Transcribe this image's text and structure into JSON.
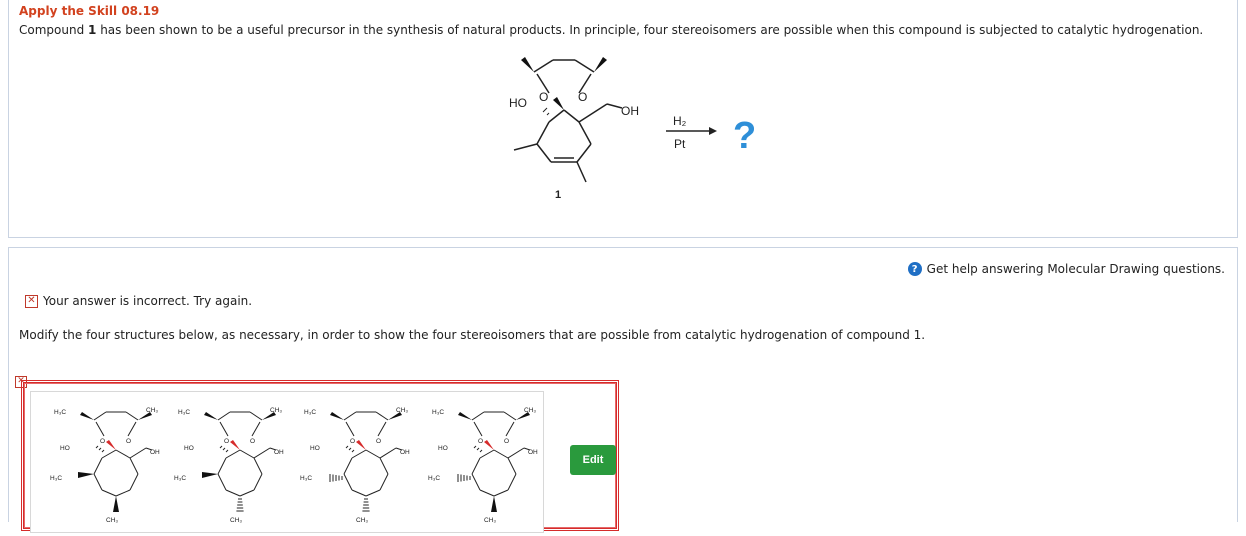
{
  "skill": {
    "title": "Apply the Skill 08.19"
  },
  "intro": {
    "prefix": "Compound ",
    "compound": "1",
    "suffix": " has been shown to be a useful precursor in the synthesis of natural products. In principle, four stereoisomers are possible when this compound is subjected to catalytic hydrogenation."
  },
  "reaction": {
    "compound_label": "1",
    "reagent_top": "H₂",
    "reagent_bottom": "Pt",
    "product": "?",
    "labels": {
      "ho": "HO",
      "oh": "OH",
      "o": "O"
    }
  },
  "help": {
    "text": "Get help answering Molecular Drawing questions."
  },
  "feedback": {
    "text": "Your answer is incorrect.  Try again."
  },
  "instruction": "Modify the four structures below, as necessary, in order to show the four stereoisomers that are possible from catalytic hydrogenation of compound 1.",
  "structures": {
    "h3c": "H₃C",
    "ch3": "CH₃",
    "ho": "HO",
    "oh": "OH",
    "o": "O"
  },
  "edit_label": "Edit",
  "colors": {
    "title": "#d2421f",
    "edit": "#2a9a3d",
    "error": "#d62b2b",
    "help": "#1f6fc5"
  }
}
